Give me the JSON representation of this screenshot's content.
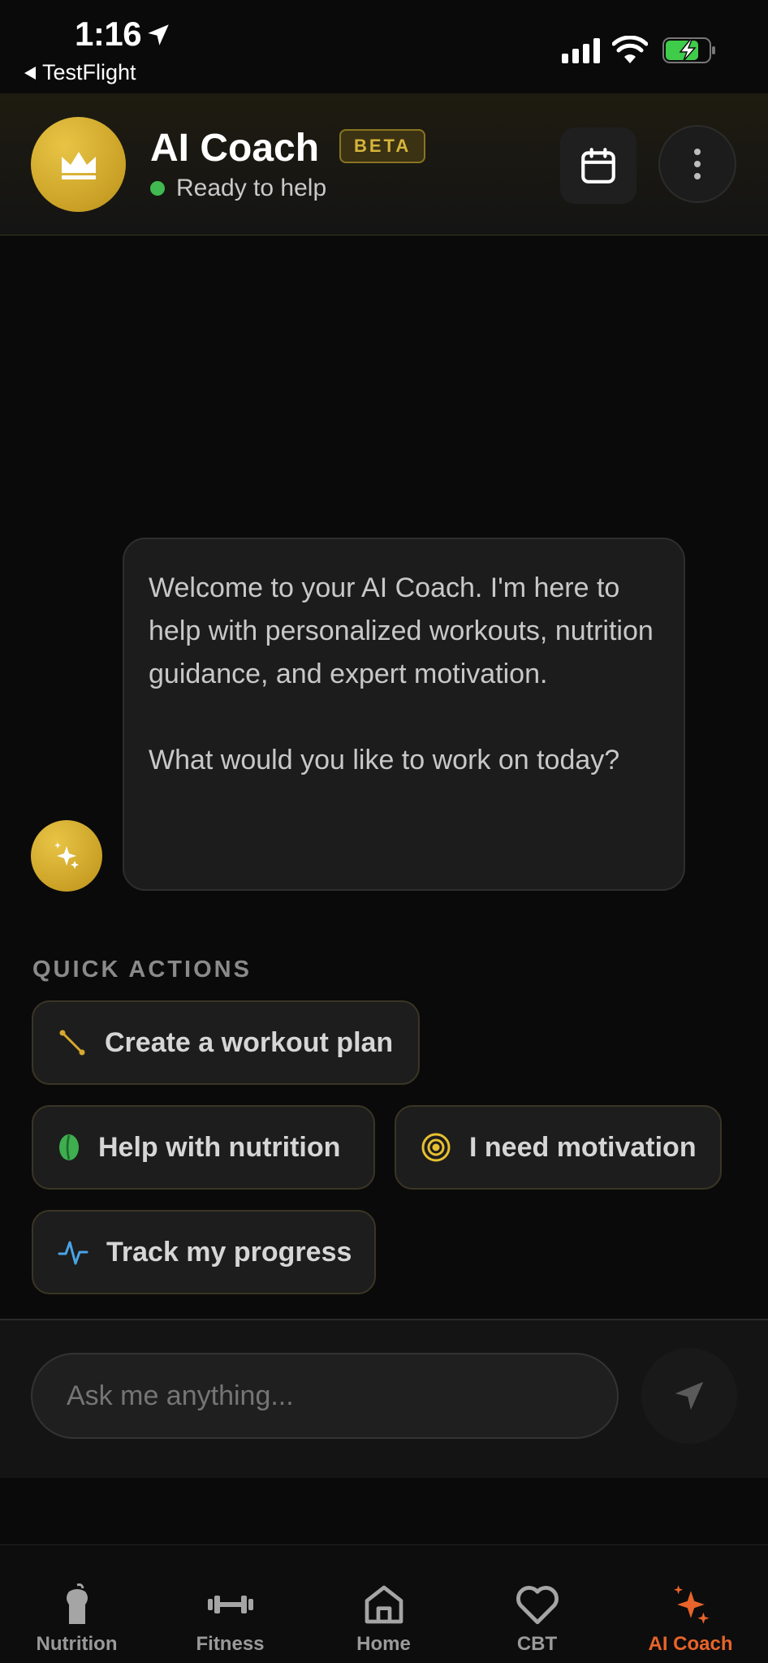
{
  "status_bar": {
    "time": "1:16",
    "back_app": "TestFlight"
  },
  "header": {
    "title": "AI Coach",
    "badge": "BETA",
    "status": "Ready to help",
    "status_color": "#3fb950",
    "avatar_icon": "crown-icon",
    "actions": [
      "calendar-icon",
      "more-vertical-icon"
    ]
  },
  "chat": {
    "messages": [
      {
        "role": "assistant",
        "paragraphs": [
          "Welcome to your AI Coach. I'm here to help with personalized workouts, nutrition guidance, and expert motivation.",
          "What would you like to work on today?"
        ]
      }
    ]
  },
  "quick_actions": {
    "label": "QUICK ACTIONS",
    "items": [
      {
        "label": "Create a workout plan",
        "icon": "dumbbell-diagonal-icon"
      },
      {
        "label": "Help with nutrition",
        "icon": "leaf-icon"
      },
      {
        "label": "I need motivation",
        "icon": "target-icon"
      },
      {
        "label": "Track my progress",
        "icon": "activity-icon"
      }
    ]
  },
  "composer": {
    "placeholder": "Ask me anything...",
    "send_icon": "send-icon"
  },
  "tabbar": {
    "items": [
      {
        "label": "Nutrition",
        "icon": "apple-icon"
      },
      {
        "label": "Fitness",
        "icon": "dumbbell-icon"
      },
      {
        "label": "Home",
        "icon": "home-icon"
      },
      {
        "label": "CBT",
        "icon": "heart-icon"
      },
      {
        "label": "AI Coach",
        "icon": "sparkles-icon",
        "active": true
      }
    ],
    "active_color": "#e8642a"
  },
  "colors": {
    "accent_gold": "#caa126",
    "background": "#0a0a0a"
  }
}
